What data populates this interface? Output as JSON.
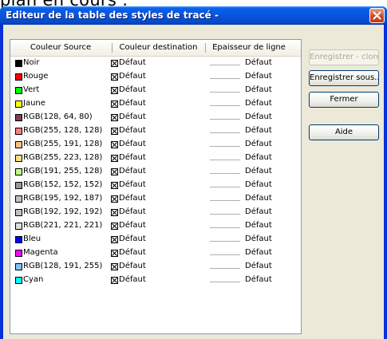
{
  "background_text": "plan en cours :",
  "window": {
    "title": "Editeur de la table des styles de tracé -"
  },
  "table": {
    "headers": [
      "Couleur Source",
      "Couleur destination",
      "Epaisseur de ligne"
    ],
    "rows": [
      {
        "source": "Noir",
        "color": "#000000",
        "dest": "Défaut",
        "thickness": "Défaut"
      },
      {
        "source": "Rouge",
        "color": "#ff0000",
        "dest": "Défaut",
        "thickness": "Défaut"
      },
      {
        "source": "Vert",
        "color": "#00ff00",
        "dest": "Défaut",
        "thickness": "Défaut"
      },
      {
        "source": "Jaune",
        "color": "#ffff00",
        "dest": "Défaut",
        "thickness": "Défaut"
      },
      {
        "source": "RGB(128, 64, 80)",
        "color": "#804050",
        "dest": "Défaut",
        "thickness": "Défaut"
      },
      {
        "source": "RGB(255, 128, 128)",
        "color": "#ff8080",
        "dest": "Défaut",
        "thickness": "Défaut"
      },
      {
        "source": "RGB(255, 191, 128)",
        "color": "#ffbf80",
        "dest": "Défaut",
        "thickness": "Défaut"
      },
      {
        "source": "RGB(255, 223, 128)",
        "color": "#ffdf80",
        "dest": "Défaut",
        "thickness": "Défaut"
      },
      {
        "source": "RGB(191, 255, 128)",
        "color": "#bfff80",
        "dest": "Défaut",
        "thickness": "Défaut"
      },
      {
        "source": "RGB(152, 152, 152)",
        "color": "#989898",
        "dest": "Défaut",
        "thickness": "Défaut"
      },
      {
        "source": "RGB(195, 192, 187)",
        "color": "#c3c0bb",
        "dest": "Défaut",
        "thickness": "Défaut"
      },
      {
        "source": "RGB(192, 192, 192)",
        "color": "#c0c0c0",
        "dest": "Défaut",
        "thickness": "Défaut"
      },
      {
        "source": "RGB(221, 221, 221)",
        "color": "#dddddd",
        "dest": "Défaut",
        "thickness": "Défaut"
      },
      {
        "source": "Bleu",
        "color": "#0000ff",
        "dest": "Défaut",
        "thickness": "Défaut"
      },
      {
        "source": "Magenta",
        "color": "#ff00ff",
        "dest": "Défaut",
        "thickness": "Défaut"
      },
      {
        "source": "RGB(128, 191, 255)",
        "color": "#80bfff",
        "dest": "Défaut",
        "thickness": "Défaut"
      },
      {
        "source": "Cyan",
        "color": "#00ffff",
        "dest": "Défaut",
        "thickness": "Défaut"
      }
    ]
  },
  "buttons": {
    "save_close": "Enregistrer - clore",
    "save_as": "Enregistrer sous...",
    "close": "Fermer",
    "help": "Aide"
  },
  "colors": {
    "titlebar": "#0855dd",
    "client": "#ece9d8",
    "close_button": "#d24a26"
  }
}
